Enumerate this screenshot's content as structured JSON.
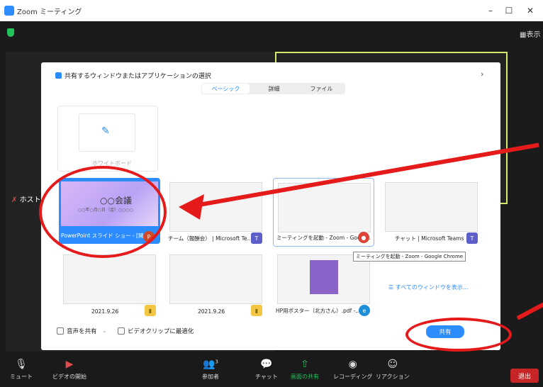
{
  "window": {
    "title": "Zoom ミーティング",
    "minimize": "–",
    "maximize": "☐",
    "close": "✕"
  },
  "meeting": {
    "view_label": "表示",
    "host_label": "ホスト"
  },
  "dialog": {
    "title": "共有するウィンドウまたはアプリケーションの選択",
    "close_glyph": "›",
    "tabs": [
      {
        "label": "ベーシック",
        "active": true
      },
      {
        "label": "詳細",
        "active": false
      },
      {
        "label": "ファイル",
        "active": false
      }
    ],
    "whiteboard": {
      "label": "ホワイトボード"
    },
    "ppt": {
      "title": "○○会議",
      "subtitle": "○○年○月○日（金）○○○○",
      "label": "PowerPoint スライド ショー - [開催...",
      "badge": "P"
    },
    "windows": [
      {
        "label": "チーム（報酬会） | Microsoft Te...",
        "badge": "T"
      },
      {
        "label": "ミーティングを起動 - Zoom - Googl...",
        "badge": "●"
      },
      {
        "label": "チャット | Microsoft Teams",
        "badge": "T"
      },
      {
        "label": "2021.9.26",
        "badge": "▮"
      },
      {
        "label": "2021.9.26",
        "badge": "▮"
      },
      {
        "label": "HP用ポスター（北方さん）.pdf -...",
        "badge": "e"
      }
    ],
    "tooltip": "ミーティングを起動 - Zoom - Google Chrome",
    "all_windows": "すべてのウィンドウを表示...",
    "share_audio": "音声を共有",
    "optimize_video": "ビデオクリップに最適化",
    "share_button": "共有"
  },
  "toolbar": {
    "mute": "ミュート",
    "video": "ビデオの開始",
    "participants": "参加者",
    "participants_count": "3",
    "chat": "チャット",
    "share": "画面の共有",
    "record": "レコーディング",
    "reactions": "リアクション",
    "leave": "退出"
  },
  "colors": {
    "accent": "#2d8cff",
    "annotation_red": "#e51b1b",
    "leave_red": "#c72525",
    "speaker_border": "#d6e86a"
  }
}
